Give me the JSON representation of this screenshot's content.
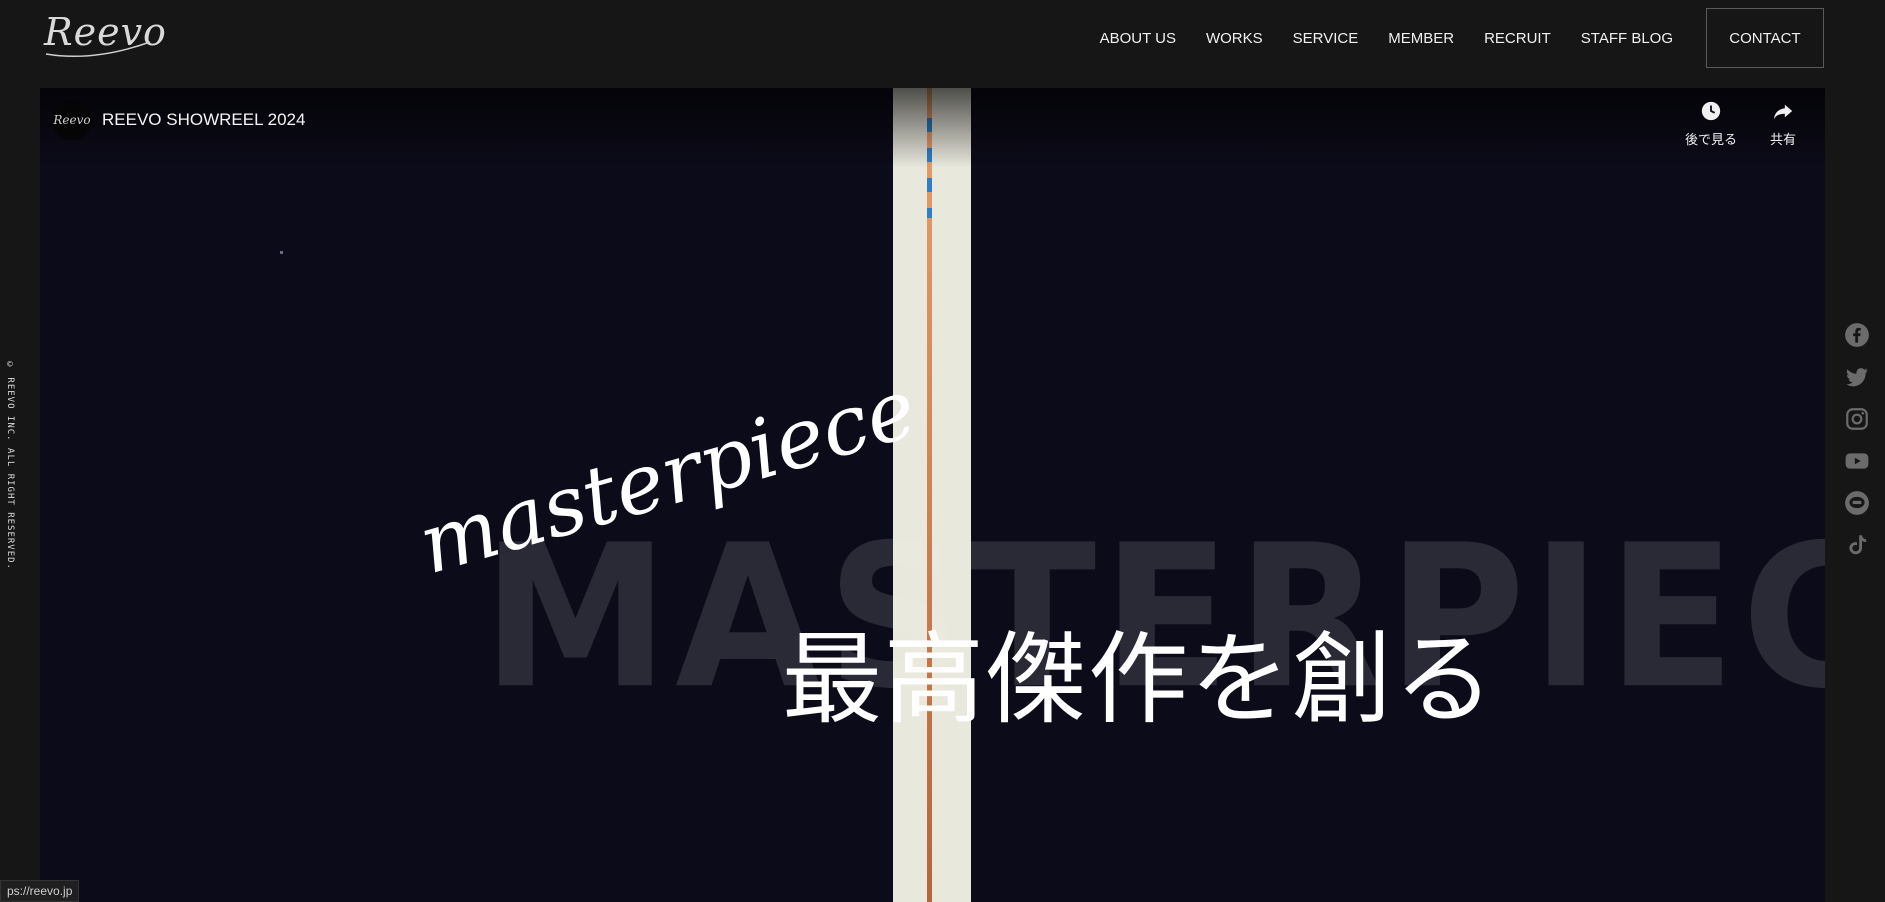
{
  "header": {
    "logo": "Reevo",
    "nav": [
      "ABOUT US",
      "WORKS",
      "SERVICE",
      "MEMBER",
      "RECRUIT",
      "STAFF BLOG"
    ],
    "contact": "CONTACT"
  },
  "video": {
    "channel_logo": "Reevo",
    "title": "REEVO SHOWREEL 2024",
    "watch_later": "後で見る",
    "share": "共有",
    "big_word": "MASTERPIECE",
    "script_word": "masterpiece",
    "jp_title": "最高傑作を創る"
  },
  "copyright": "© REEVO INC. ALL RIGHT RESERVED.",
  "social_icons": [
    "facebook-icon",
    "twitter-icon",
    "instagram-icon",
    "youtube-icon",
    "line-icon",
    "tiktok-icon"
  ],
  "status_bar": "ps://reevo.jp"
}
